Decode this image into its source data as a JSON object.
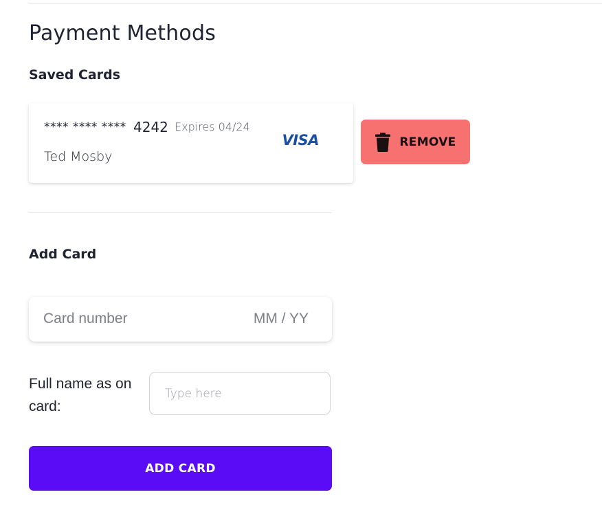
{
  "page": {
    "title": "Payment Methods"
  },
  "saved_cards": {
    "heading": "Saved Cards",
    "items": [
      {
        "masked_number": "**** **** ****",
        "last4": "4242",
        "expiry": "Expires 04/24",
        "holder": "Ted Mosby",
        "brand": "VISA",
        "brand_icon": "visa-logo",
        "brand_color": "#1a4fa3"
      }
    ],
    "remove_button": {
      "label": "REMOVE",
      "icon": "trash-icon",
      "color": "#f87171"
    }
  },
  "add_card": {
    "heading": "Add Card",
    "card_number_placeholder": "Card number",
    "expiry_placeholder": "MM / YY",
    "name_label": "Full name as on card:",
    "name_placeholder": "Type here",
    "submit_label": "ADD CARD",
    "submit_color": "#5a0cf7"
  }
}
